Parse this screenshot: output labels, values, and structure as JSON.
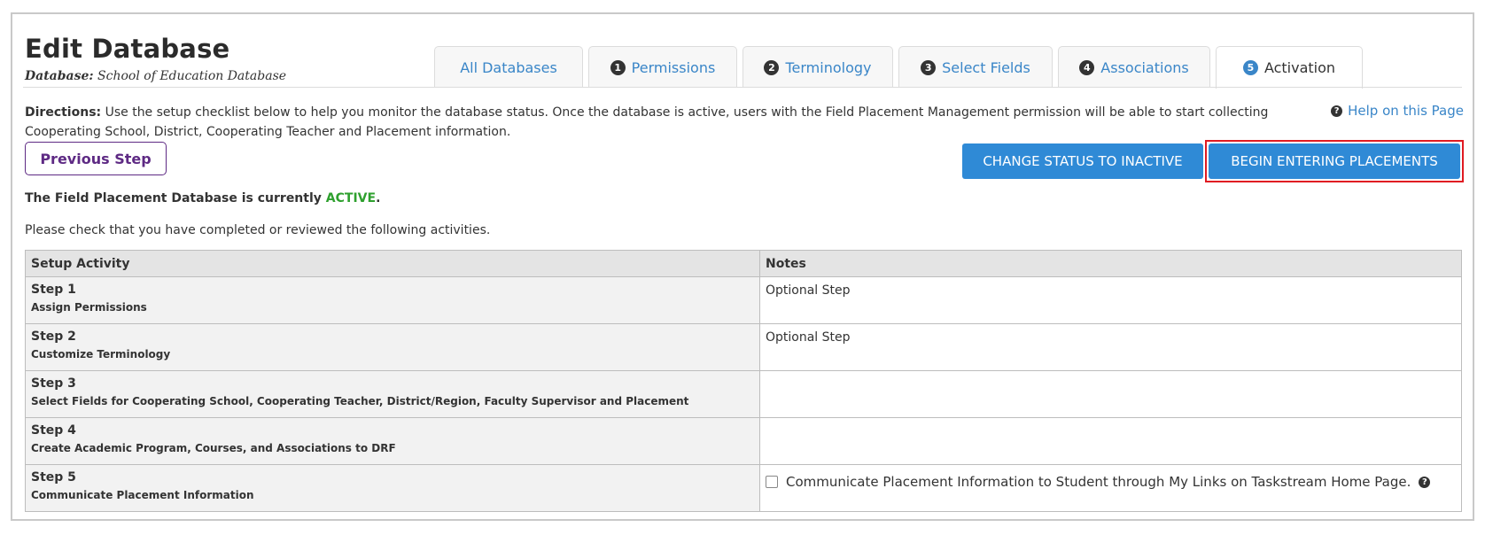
{
  "header": {
    "title": "Edit Database",
    "database_label": "Database:",
    "database_name": "School of Education Database"
  },
  "tabs": [
    {
      "label": "All Databases",
      "num": ""
    },
    {
      "label": "Permissions",
      "num": "1"
    },
    {
      "label": "Terminology",
      "num": "2"
    },
    {
      "label": "Select Fields",
      "num": "3"
    },
    {
      "label": "Associations",
      "num": "4"
    },
    {
      "label": "Activation",
      "num": "5",
      "active": true
    }
  ],
  "directions": {
    "label": "Directions:",
    "text": "Use the setup checklist below to help you monitor the database status. Once the database is active, users with the Field Placement Management permission will be able to start collecting Cooperating School, District, Cooperating Teacher and Placement information."
  },
  "help": {
    "label": "Help on this Page",
    "icon": "question-circle-icon"
  },
  "buttons": {
    "previous": "Previous Step",
    "inactive": "CHANGE STATUS TO INACTIVE",
    "begin": "BEGIN ENTERING PLACEMENTS"
  },
  "status": {
    "prefix": "The Field Placement Database is currently",
    "value": "ACTIVE",
    "suffix": "."
  },
  "instruction": "Please check that you have completed or reviewed the following activities.",
  "table": {
    "headers": [
      "Setup Activity",
      "Notes"
    ],
    "rows": [
      {
        "step": "Step 1",
        "desc": "Assign Permissions",
        "note": "Optional Step"
      },
      {
        "step": "Step 2",
        "desc": "Customize Terminology",
        "note": "Optional Step"
      },
      {
        "step": "Step 3",
        "desc": "Select Fields for Cooperating School, Cooperating Teacher, District/Region, Faculty Supervisor and Placement",
        "note": ""
      },
      {
        "step": "Step 4",
        "desc": "Create Academic Program, Courses, and Associations to DRF",
        "note": ""
      },
      {
        "step": "Step 5",
        "desc": "Communicate Placement Information",
        "note": "Communicate Placement Information to Student through My Links on Taskstream Home Page."
      }
    ]
  },
  "colors": {
    "accent": "#2f8ad6",
    "link": "#3a86c8",
    "previous": "#5e2a84",
    "active_status": "#2ea02e",
    "highlight": "#e01b22"
  }
}
